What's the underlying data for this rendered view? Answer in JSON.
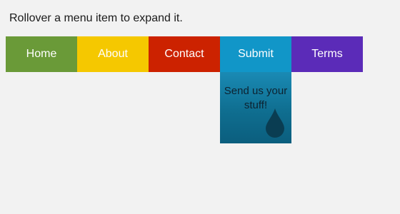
{
  "instruction": "Rollover a menu item to expand it.",
  "menu": {
    "items": [
      {
        "label": "Home"
      },
      {
        "label": "About"
      },
      {
        "label": "Contact"
      },
      {
        "label": "Submit",
        "expanded": true,
        "submenu_text": "Send us your stuff!"
      },
      {
        "label": "Terms"
      }
    ]
  },
  "colors": {
    "home": "#6a9a38",
    "about": "#f5c800",
    "contact": "#cc2200",
    "submit": "#1196c8",
    "terms": "#5b2bb8",
    "background": "#f2f2f2"
  },
  "icons": {
    "submenu_icon": "water-drop-icon"
  }
}
